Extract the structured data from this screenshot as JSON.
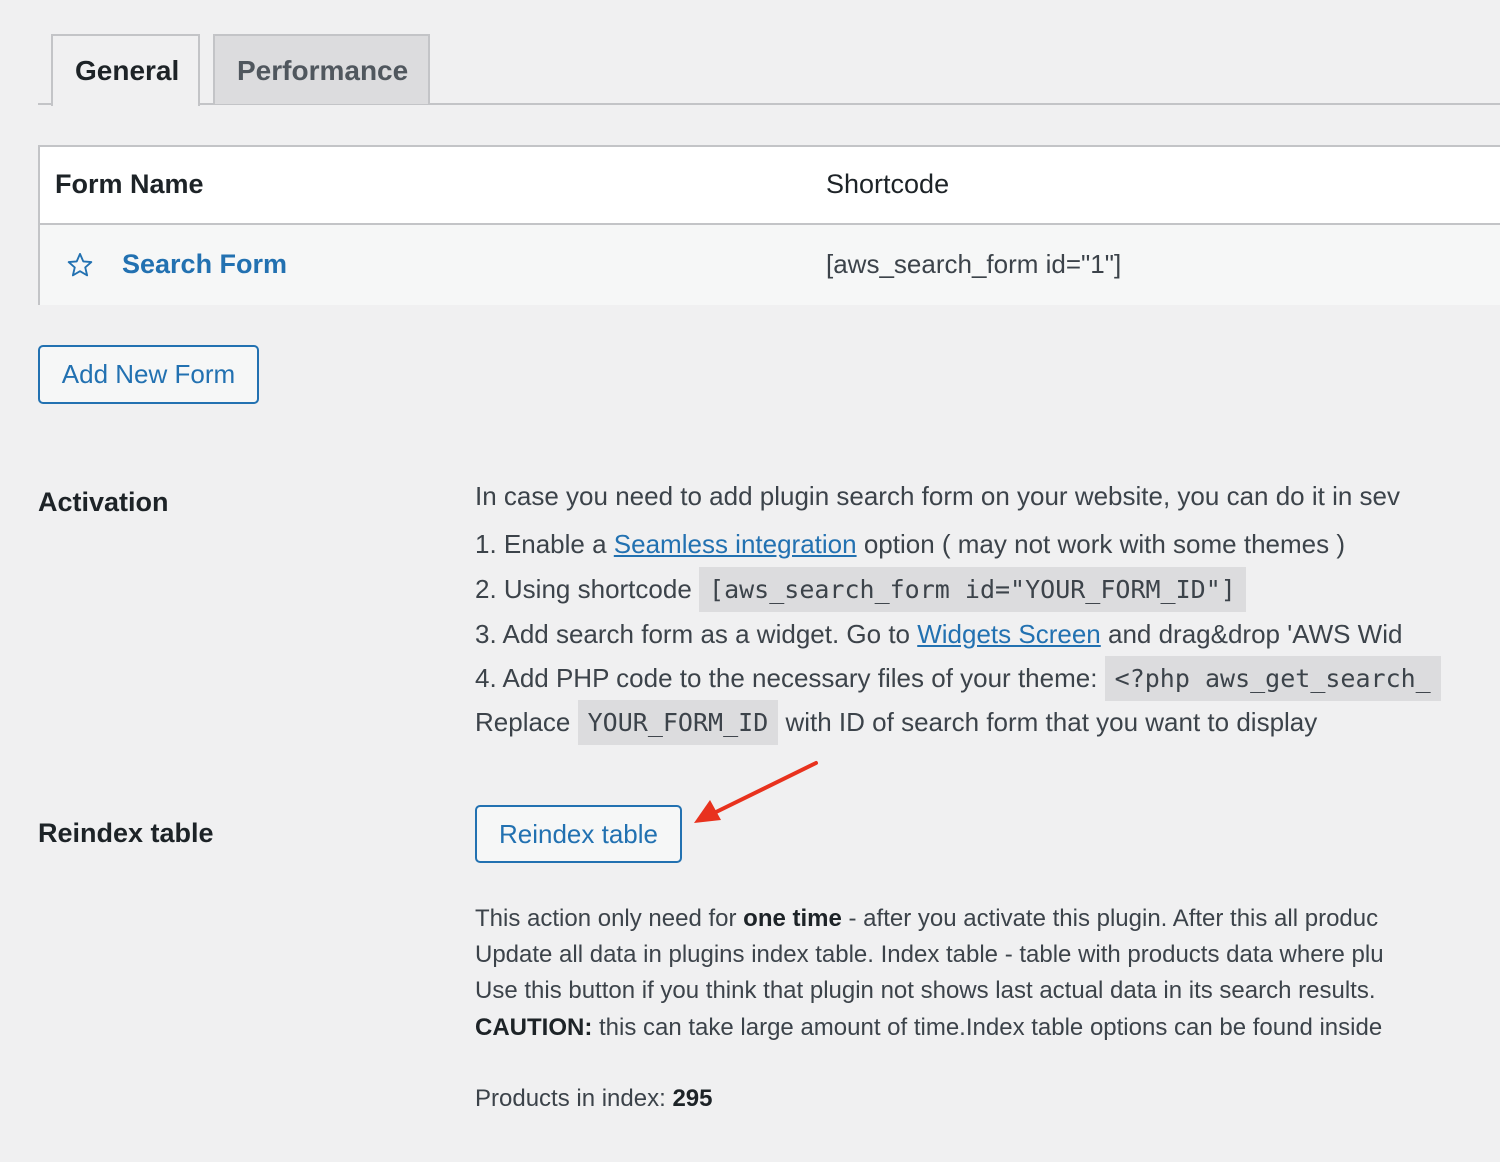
{
  "tabs": [
    {
      "label": "General",
      "active": true
    },
    {
      "label": "Performance",
      "active": false
    }
  ],
  "table": {
    "headers": {
      "name": "Form Name",
      "shortcode": "Shortcode"
    },
    "rows": [
      {
        "name": "Search Form",
        "shortcode": "[aws_search_form id=\"1\"]"
      }
    ]
  },
  "add_form_button": "Add New Form",
  "activation": {
    "label": "Activation",
    "intro": "In case you need to add plugin search form on your website, you can do it in sev",
    "step1_pre": "1. Enable a ",
    "step1_link": "Seamless integration",
    "step1_post": " option ( may not work with some themes )",
    "step2_pre": "2. Using shortcode ",
    "step2_code": "[aws_search_form id=\"YOUR_FORM_ID\"]",
    "step3_pre": "3. Add search form as a widget. Go to ",
    "step3_link": "Widgets Screen",
    "step3_post": " and drag&drop 'AWS Wid",
    "step4_pre": "4. Add PHP code to the necessary files of your theme: ",
    "step4_code": "<?php aws_get_search_",
    "replace_pre": "Replace ",
    "replace_code": "YOUR_FORM_ID",
    "replace_post": " with ID of search form that you want to display"
  },
  "reindex": {
    "label": "Reindex table",
    "button": "Reindex table",
    "d1_pre": "This action only need for ",
    "d1_bold": "one time",
    "d1_post": " - after you activate this plugin. After this all produc",
    "d2": "Update all data in plugins index table. Index table - table with products data where plu",
    "d3": "Use this button if you think that plugin not shows last actual data in its search results.",
    "d4_bold": "CAUTION:",
    "d4_post": " this can take large amount of time.Index table options can be found inside",
    "products_label": "Products in index: ",
    "products_count": "295"
  },
  "colors": {
    "background": "#f0f0f1",
    "link_blue": "#2271b1",
    "arrow_red": "#e8321e",
    "border": "#c3c4c7"
  },
  "icons": [
    "star-outline-icon",
    "red-arrow-annotation"
  ]
}
